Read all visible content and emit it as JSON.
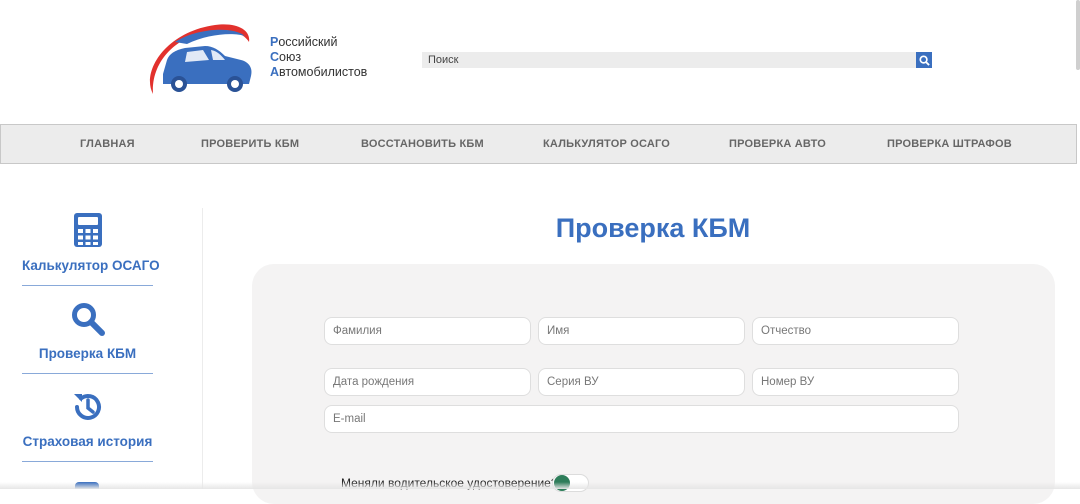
{
  "header": {
    "logo_lines": [
      {
        "cap": "Р",
        "rest": "оссийский"
      },
      {
        "cap": "С",
        "rest": "оюз"
      },
      {
        "cap": "А",
        "rest": "втомобилистов"
      }
    ]
  },
  "search": {
    "placeholder": "Поиск"
  },
  "nav": {
    "items": [
      "ГЛАВНАЯ",
      "ПРОВЕРИТЬ КБМ",
      "ВОССТАНОВИТЬ КБМ",
      "КАЛЬКУЛЯТОР ОСАГО",
      "ПРОВЕРКА АВТО",
      "ПРОВЕРКА ШТРАФОВ"
    ]
  },
  "sidebar": {
    "items": [
      {
        "label": "Калькулятор ОСАГО",
        "icon": "calculator-icon"
      },
      {
        "label": "Проверка КБМ",
        "icon": "search-icon"
      },
      {
        "label": "Страховая история",
        "icon": "history-icon"
      }
    ]
  },
  "main": {
    "title": "Проверка КБМ",
    "fields": {
      "last_name": "Фамилия",
      "first_name": "Имя",
      "patronymic": "Отчество",
      "birth_date": "Дата рождения",
      "license_series": "Серия ВУ",
      "license_number": "Номер ВУ",
      "email": "E-mail"
    },
    "license_changed_question": "Меняли водительское удостоверение?",
    "license_changed_value": false
  },
  "colors": {
    "accent": "#3a6fbf",
    "logo_red": "#e2312d",
    "toggle": "#2e7d5a"
  }
}
